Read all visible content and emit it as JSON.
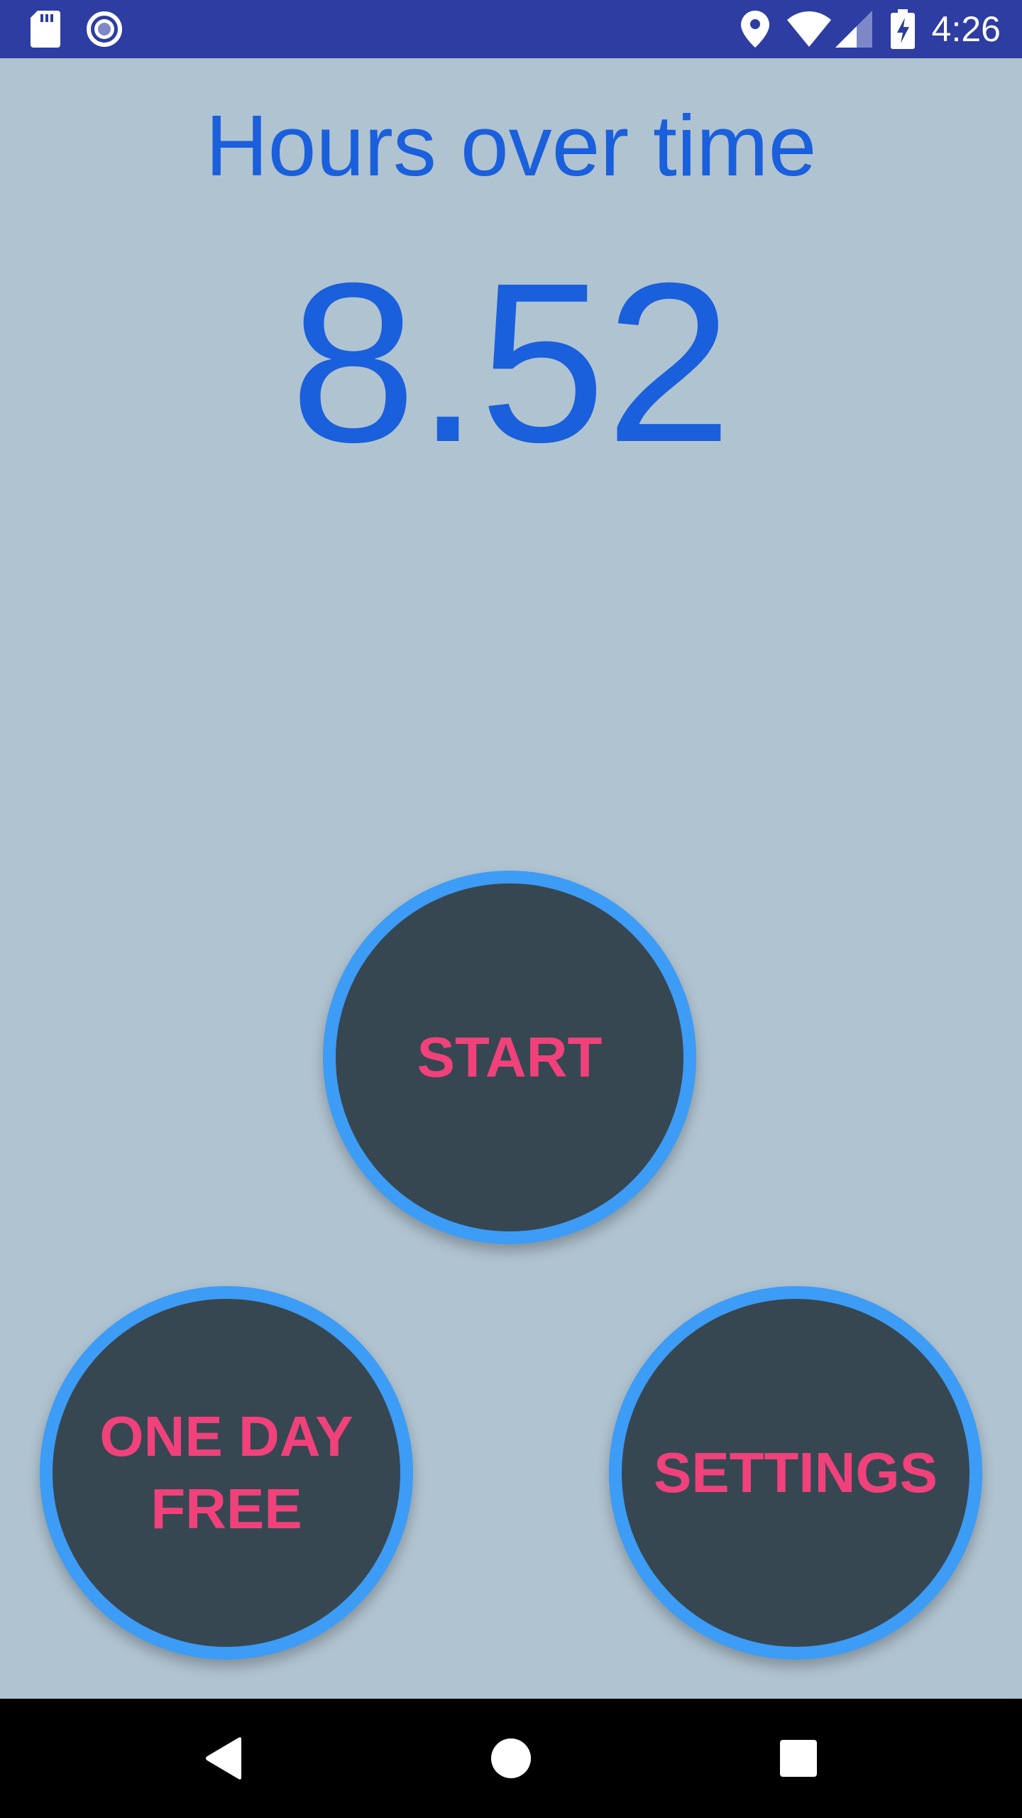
{
  "status_bar": {
    "time": "4:26",
    "left_icons": [
      "sd-card-icon",
      "record-icon"
    ],
    "right_icons": [
      "location-icon",
      "wifi-icon",
      "cellular-signal-icon",
      "battery-charging-icon"
    ],
    "background_color": "#2d3da1"
  },
  "main": {
    "title": "Hours over time",
    "hours_value": "8.52",
    "text_color": "#1a5fdc",
    "background_color": "#b0c3d0"
  },
  "buttons": {
    "start_label": "START",
    "one_day_free_label": "ONE DAY\nFREE",
    "settings_label": "SETTINGS",
    "fill_color": "#364752",
    "ring_color": "#3d9cf5",
    "label_color": "#f0417b"
  },
  "nav_bar": {
    "icons": [
      "back-icon",
      "home-icon",
      "recents-icon"
    ]
  }
}
